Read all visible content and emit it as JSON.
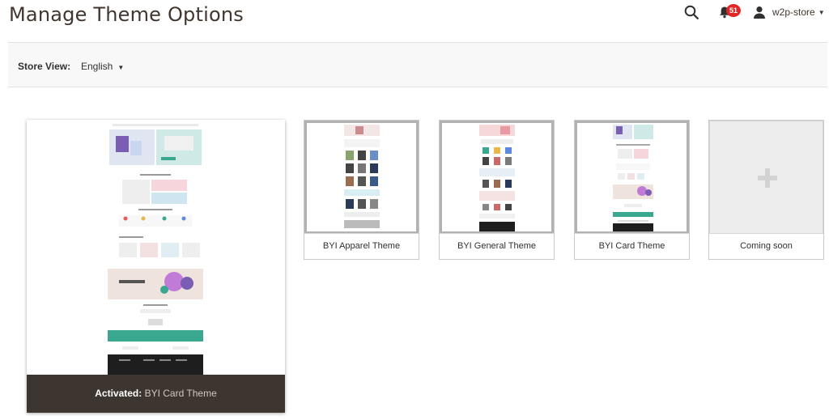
{
  "header": {
    "title": "Manage Theme Options",
    "notification_count": "51",
    "user_name": "w2p-store",
    "icons": [
      "search-icon",
      "bell-icon",
      "user-icon",
      "caret-down-icon"
    ]
  },
  "store_view": {
    "label": "Store View:",
    "selected": "English"
  },
  "active_theme": {
    "label": "Activated:",
    "name": "BYI Card Theme"
  },
  "themes": [
    {
      "name": "BYI Apparel Theme"
    },
    {
      "name": "BYI General Theme"
    },
    {
      "name": "BYI Card Theme"
    },
    {
      "name": "Coming soon",
      "icon": "plus-icon"
    }
  ],
  "colors": {
    "badge": "#e22626",
    "footer_dark": "#3d3530",
    "teal": "#3aa88f"
  }
}
